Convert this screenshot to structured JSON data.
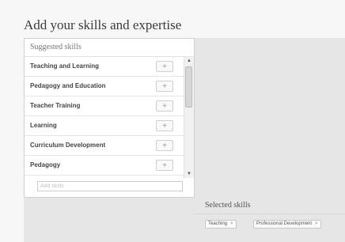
{
  "page": {
    "title": "Add your skills and expertise"
  },
  "suggested": {
    "heading": "Suggested skills",
    "add_icon": "plus-icon",
    "items": [
      {
        "label": "Teaching and Learning",
        "action": "+"
      },
      {
        "label": "Pedagogy and Education",
        "action": "+"
      },
      {
        "label": "Teacher Training",
        "action": "+"
      },
      {
        "label": "Learning",
        "action": "+"
      },
      {
        "label": "Curriculum Development",
        "action": "+"
      },
      {
        "label": "Pedagogy",
        "action": "+"
      }
    ],
    "input": {
      "placeholder": "Add skills",
      "value": ""
    },
    "scroll": {
      "up": "▲",
      "down": "▼"
    }
  },
  "selected": {
    "heading": "Selected skills",
    "remove_glyph": "×",
    "chips": [
      {
        "label": "Teaching"
      },
      {
        "label": "Professional Development"
      }
    ]
  }
}
